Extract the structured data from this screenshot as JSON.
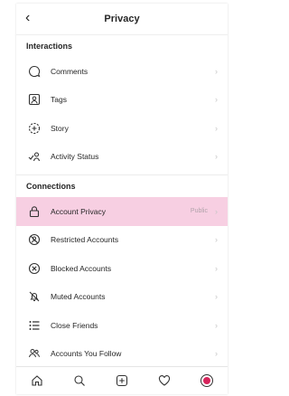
{
  "header": {
    "back_icon": "chevron-left-icon",
    "title": "Privacy"
  },
  "interactions": {
    "title": "Interactions",
    "items": [
      {
        "label": "Comments",
        "icon": "comment-icon"
      },
      {
        "label": "Tags",
        "icon": "tag-icon"
      },
      {
        "label": "Story",
        "icon": "story-icon"
      },
      {
        "label": "Activity Status",
        "icon": "activity-status-icon"
      }
    ]
  },
  "connections": {
    "title": "Connections",
    "items": [
      {
        "label": "Account Privacy",
        "value": "Public",
        "icon": "lock-icon",
        "highlighted": true
      },
      {
        "label": "Restricted Accounts",
        "icon": "restricted-icon"
      },
      {
        "label": "Blocked Accounts",
        "icon": "blocked-icon"
      },
      {
        "label": "Muted Accounts",
        "icon": "muted-icon"
      },
      {
        "label": "Close Friends",
        "icon": "list-icon"
      },
      {
        "label": "Accounts You Follow",
        "icon": "following-icon"
      }
    ]
  },
  "colors": {
    "highlight": "#f7cfe2",
    "accent": "#d6245b"
  },
  "nav": [
    "home-icon",
    "search-icon",
    "add-post-icon",
    "heart-icon",
    "profile-icon"
  ]
}
